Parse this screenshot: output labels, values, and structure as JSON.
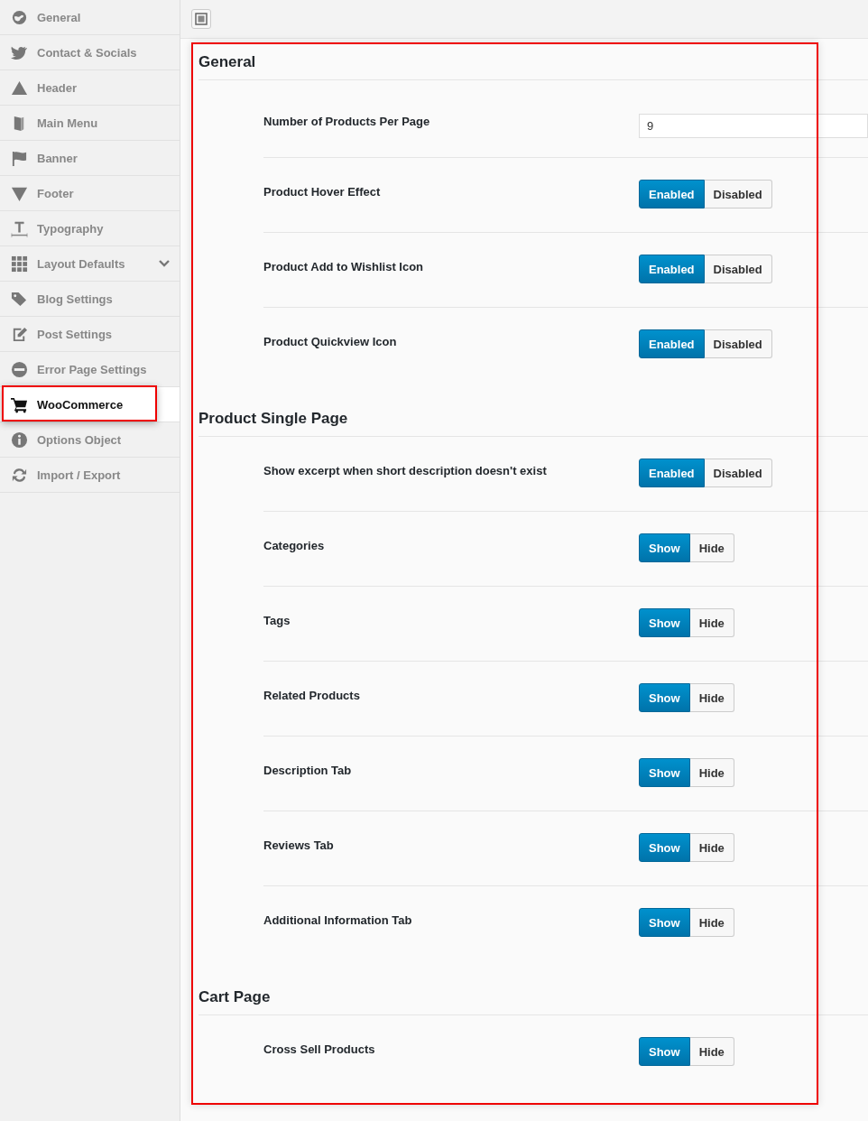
{
  "sidebar": {
    "items": [
      {
        "label": "General",
        "selected": false,
        "kind": "item"
      },
      {
        "label": "Contact & Socials",
        "selected": false,
        "kind": "item"
      },
      {
        "label": "Header",
        "selected": false,
        "kind": "item"
      },
      {
        "label": "Main Menu",
        "selected": false,
        "kind": "item"
      },
      {
        "label": "Banner",
        "selected": false,
        "kind": "item"
      },
      {
        "label": "Footer",
        "selected": false,
        "kind": "item"
      },
      {
        "label": "Typography",
        "selected": false,
        "kind": "item"
      },
      {
        "label": "Layout Defaults",
        "selected": false,
        "kind": "group"
      },
      {
        "label": "Blog Settings",
        "selected": false,
        "kind": "item"
      },
      {
        "label": "Post Settings",
        "selected": false,
        "kind": "item"
      },
      {
        "label": "Error Page Settings",
        "selected": false,
        "kind": "item"
      },
      {
        "label": "WooCommerce",
        "selected": true,
        "kind": "item"
      },
      {
        "label": "Options Object",
        "selected": false,
        "kind": "item"
      },
      {
        "label": "Import / Export",
        "selected": false,
        "kind": "item"
      }
    ]
  },
  "sections": [
    {
      "title": "General",
      "rows": [
        {
          "label": "Number of Products Per Page",
          "kind": "text",
          "value": "9"
        },
        {
          "label": "Product Hover Effect",
          "kind": "toggle",
          "options": [
            {
              "label": "Enabled",
              "selected": true
            },
            {
              "label": "Disabled",
              "selected": false
            }
          ]
        },
        {
          "label": "Product Add to Wishlist Icon",
          "kind": "toggle",
          "options": [
            {
              "label": "Enabled",
              "selected": true
            },
            {
              "label": "Disabled",
              "selected": false
            }
          ]
        },
        {
          "label": "Product Quickview Icon",
          "kind": "toggle",
          "options": [
            {
              "label": "Enabled",
              "selected": true
            },
            {
              "label": "Disabled",
              "selected": false
            }
          ]
        }
      ]
    },
    {
      "title": "Product Single Page",
      "rows": [
        {
          "label": "Show excerpt when short description doesn't exist",
          "kind": "toggle",
          "options": [
            {
              "label": "Enabled",
              "selected": true
            },
            {
              "label": "Disabled",
              "selected": false
            }
          ]
        },
        {
          "label": "Categories",
          "kind": "toggle",
          "options": [
            {
              "label": "Show",
              "selected": true
            },
            {
              "label": "Hide",
              "selected": false
            }
          ]
        },
        {
          "label": "Tags",
          "kind": "toggle",
          "options": [
            {
              "label": "Show",
              "selected": true
            },
            {
              "label": "Hide",
              "selected": false
            }
          ]
        },
        {
          "label": "Related Products",
          "kind": "toggle",
          "options": [
            {
              "label": "Show",
              "selected": true
            },
            {
              "label": "Hide",
              "selected": false
            }
          ]
        },
        {
          "label": "Description Tab",
          "kind": "toggle",
          "options": [
            {
              "label": "Show",
              "selected": true
            },
            {
              "label": "Hide",
              "selected": false
            }
          ]
        },
        {
          "label": "Reviews Tab",
          "kind": "toggle",
          "options": [
            {
              "label": "Show",
              "selected": true
            },
            {
              "label": "Hide",
              "selected": false
            }
          ]
        },
        {
          "label": "Additional Information Tab",
          "kind": "toggle",
          "options": [
            {
              "label": "Show",
              "selected": true
            },
            {
              "label": "Hide",
              "selected": false
            }
          ]
        }
      ]
    },
    {
      "title": "Cart Page",
      "rows": [
        {
          "label": "Cross Sell Products",
          "kind": "toggle",
          "options": [
            {
              "label": "Show",
              "selected": true
            },
            {
              "label": "Hide",
              "selected": false
            }
          ]
        }
      ]
    }
  ]
}
